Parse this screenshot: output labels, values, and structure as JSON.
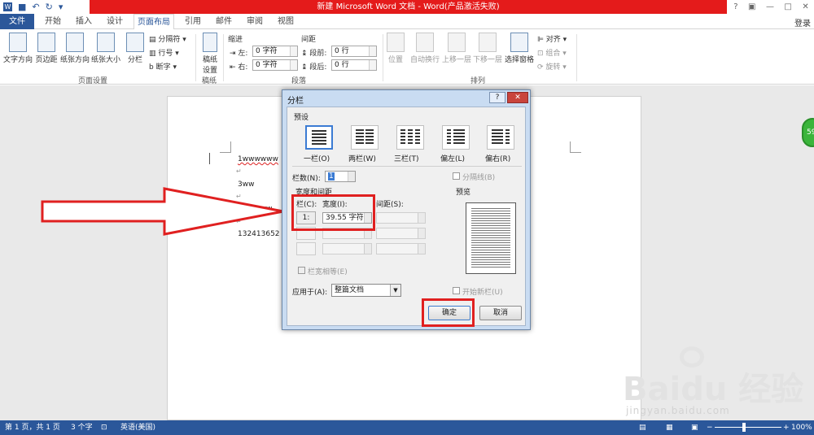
{
  "title_bar": {
    "title": "新建 Microsoft Word 文档 - Word(产品激活失败)",
    "controls": [
      "?",
      "▣",
      "—",
      "□",
      "✕"
    ]
  },
  "tabs": [
    "文件",
    "开始",
    "插入",
    "设计",
    "页面布局",
    "引用",
    "邮件",
    "审阅",
    "视图"
  ],
  "active_tab": "页面布局",
  "login": "登录",
  "ribbon": {
    "page_setup": {
      "text_direction": "文字方向",
      "margins": "页边距",
      "orientation": "纸张方向",
      "size": "纸张大小",
      "columns": "分栏",
      "breaks": "分隔符",
      "line_numbers": "行号",
      "hyphenation": "断字",
      "group": "页面设置"
    },
    "manuscript": {
      "settings_line1": "稿纸",
      "settings_line2": "设置",
      "group": "稿纸"
    },
    "paragraph": {
      "indent": "缩进",
      "left": "左:",
      "left_value": "0 字符",
      "right": "右:",
      "right_value": "0 字符",
      "spacing": "间距",
      "before": "段前:",
      "before_value": "0 行",
      "after": "段后:",
      "after_value": "0 行",
      "group": "段落"
    },
    "arrange": {
      "position": "位置",
      "wrap": "自动换行",
      "forward": "上移一层",
      "backward": "下移一层",
      "selection_pane": "选择窗格",
      "align": "对齐",
      "group_btn": "组合",
      "rotate": "旋转",
      "group": "排列"
    }
  },
  "document": {
    "lines": [
      "1wwwwww",
      "3ww",
      "2wwwww",
      "132413652"
    ],
    "para_mark": "↵"
  },
  "dialog": {
    "title": "分栏",
    "help": "?",
    "close": "✕",
    "presets_label": "预设",
    "presets": [
      "一栏(O)",
      "两栏(W)",
      "三栏(T)",
      "偏左(L)",
      "偏右(R)"
    ],
    "num_cols_label": "栏数(N):",
    "num_cols_value": "1",
    "separator": "分隔线(B)",
    "width_spacing": "宽度和间距",
    "preview_label": "预览",
    "col_header": "栏(C):",
    "width_header": "宽度(I):",
    "spacing_header": "间距(S):",
    "col1": "1:",
    "width1": "39.55 字符",
    "equal_width": "栏宽相等(E)",
    "apply_label": "应用于(A):",
    "apply_value": "整篇文档",
    "start_new": "开始新栏(U)",
    "ok": "确定",
    "cancel": "取消"
  },
  "status": {
    "page": "第 1 页，共 1 页",
    "words": "3 个字",
    "lang": "英语(美国)",
    "zoom": "100%",
    "minus": "−",
    "plus": "+"
  },
  "badge": "59",
  "watermark": {
    "brand": "Baidu 经验",
    "url": "jingyan.baidu.com"
  },
  "colors": {
    "title_red": "#e41b1b",
    "word_blue": "#2b579a",
    "highlight_red": "#e02020"
  }
}
